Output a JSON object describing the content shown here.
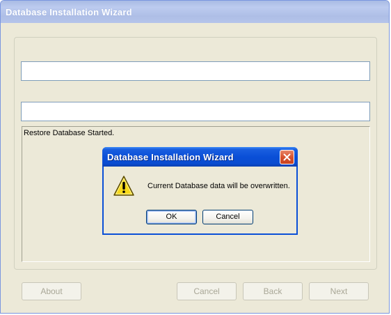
{
  "window": {
    "title": "Database Installation Wizard"
  },
  "fields": {
    "field1_value": "",
    "field2_value": ""
  },
  "log": {
    "text": "Restore Database Started."
  },
  "buttons": {
    "about": "About",
    "cancel": "Cancel",
    "back": "Back",
    "next": "Next"
  },
  "dialog": {
    "title": "Database Installation Wizard",
    "message": "Current Database data will be overwritten.",
    "ok": "OK",
    "cancel": "Cancel",
    "icon": "warning-icon",
    "close_icon": "close-icon"
  },
  "colors": {
    "dialog_title_bar": "#0a4fd7",
    "window_face": "#ece9d8",
    "inactive_title_bar": "#aebee6",
    "disabled_text": "#a9a797",
    "close_button": "#d8532f",
    "warning_yellow": "#f7d91a"
  }
}
